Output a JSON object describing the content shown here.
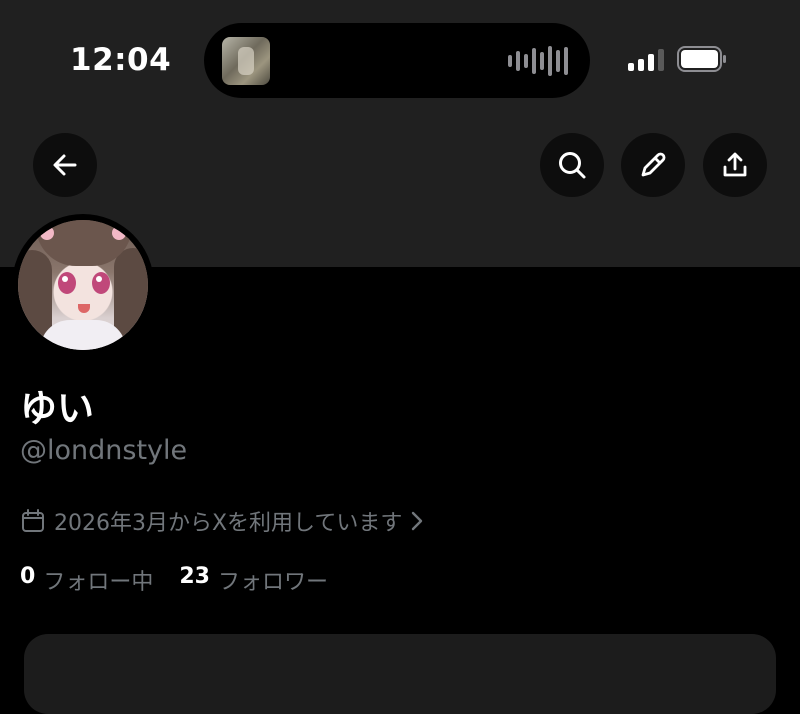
{
  "status_bar": {
    "time": "12:04"
  },
  "header": {
    "icons": [
      "back-arrow-icon",
      "search-icon",
      "edit-pencil-icon",
      "share-icon"
    ]
  },
  "profile": {
    "display_name": "ゆい",
    "handle": "@londnstyle",
    "joined_text": "2026年3月からXを利用しています",
    "following_count": "0",
    "following_label": "フォロー中",
    "followers_count": "23",
    "followers_label": "フォロワー"
  },
  "colors": {
    "background": "#000000",
    "banner": "#202020",
    "secondary_text": "#71767b",
    "primary_text": "#ffffff"
  }
}
